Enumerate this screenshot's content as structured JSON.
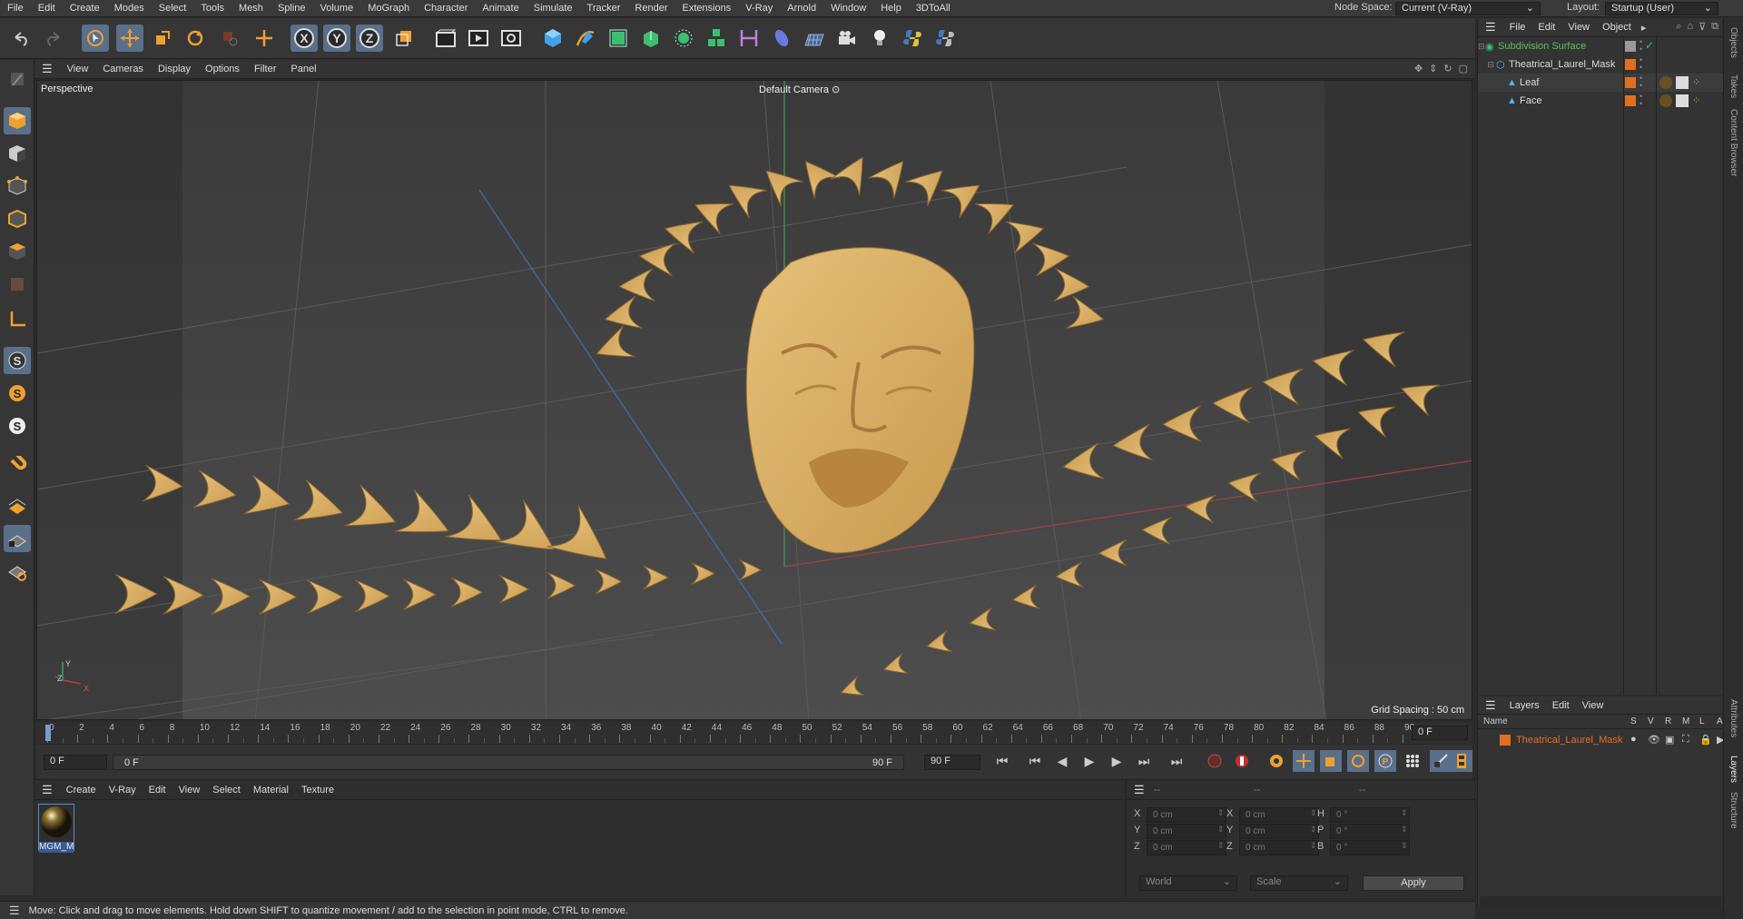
{
  "menubar": {
    "items": [
      "File",
      "Edit",
      "Create",
      "Modes",
      "Select",
      "Tools",
      "Mesh",
      "Spline",
      "Volume",
      "MoGraph",
      "Character",
      "Animate",
      "Simulate",
      "Tracker",
      "Render",
      "Extensions",
      "V-Ray",
      "Arnold",
      "Window",
      "Help",
      "3DToAll"
    ],
    "node_space_label": "Node Space:",
    "node_space_value": "Current (V-Ray)",
    "layout_label": "Layout:",
    "layout_value": "Startup (User)"
  },
  "viewport": {
    "menu": [
      "View",
      "Cameras",
      "Display",
      "Options",
      "Filter",
      "Panel"
    ],
    "view_name": "Perspective",
    "camera": "Default Camera",
    "grid_spacing": "Grid Spacing : 50 cm",
    "axis_x": "X",
    "axis_y": "Y",
    "axis_z": "Z"
  },
  "timeline": {
    "ticks": [
      "0",
      "2",
      "4",
      "6",
      "8",
      "10",
      "12",
      "14",
      "16",
      "18",
      "20",
      "22",
      "24",
      "26",
      "28",
      "30",
      "32",
      "34",
      "36",
      "38",
      "40",
      "42",
      "44",
      "46",
      "48",
      "50",
      "52",
      "54",
      "56",
      "58",
      "60",
      "62",
      "64",
      "66",
      "68",
      "70",
      "72",
      "74",
      "76",
      "78",
      "80",
      "82",
      "84",
      "86",
      "88",
      "90"
    ],
    "current": "0 F"
  },
  "transport": {
    "start": "0 F",
    "range_start": "0 F",
    "range_end": "90 F",
    "end": "90 F"
  },
  "materials": {
    "menu": [
      "Create",
      "V-Ray",
      "Edit",
      "View",
      "Select",
      "Material",
      "Texture"
    ],
    "items": [
      {
        "name": "MGM_M"
      }
    ]
  },
  "coords": {
    "header": [
      "--",
      "--",
      "--"
    ],
    "rows": [
      {
        "a": "X",
        "av": "0 cm",
        "b": "X",
        "bv": "0 cm",
        "c": "H",
        "cv": "0 °"
      },
      {
        "a": "Y",
        "av": "0 cm",
        "b": "Y",
        "bv": "0 cm",
        "c": "P",
        "cv": "0 °"
      },
      {
        "a": "Z",
        "av": "0 cm",
        "b": "Z",
        "bv": "0 cm",
        "c": "B",
        "cv": "0 °"
      }
    ],
    "space": "World",
    "mode": "Scale",
    "apply": "Apply"
  },
  "objects": {
    "menu": [
      "File",
      "Edit",
      "View",
      "Object"
    ],
    "tree": [
      {
        "name": "Subdivision Surface",
        "indent": 0,
        "color": "#5fbf5f"
      },
      {
        "name": "Theatrical_Laurel_Mask",
        "indent": 1,
        "color": "#ddd"
      },
      {
        "name": "Leaf",
        "indent": 2,
        "color": "#ddd"
      },
      {
        "name": "Face",
        "indent": 2,
        "color": "#ddd"
      }
    ]
  },
  "layers": {
    "menu": [
      "Layers",
      "Edit",
      "View"
    ],
    "columns": [
      "Name",
      "S",
      "V",
      "R",
      "M",
      "L",
      "A"
    ],
    "items": [
      {
        "name": "Theatrical_Laurel_Mask",
        "color": "#e07020"
      }
    ]
  },
  "side_tabs": [
    "Objects",
    "Takes",
    "Content Browser",
    "Attributes",
    "Layers",
    "Structure"
  ],
  "status": "Move: Click and drag to move elements. Hold down SHIFT to quantize movement / add to the selection in point mode, CTRL to remove."
}
